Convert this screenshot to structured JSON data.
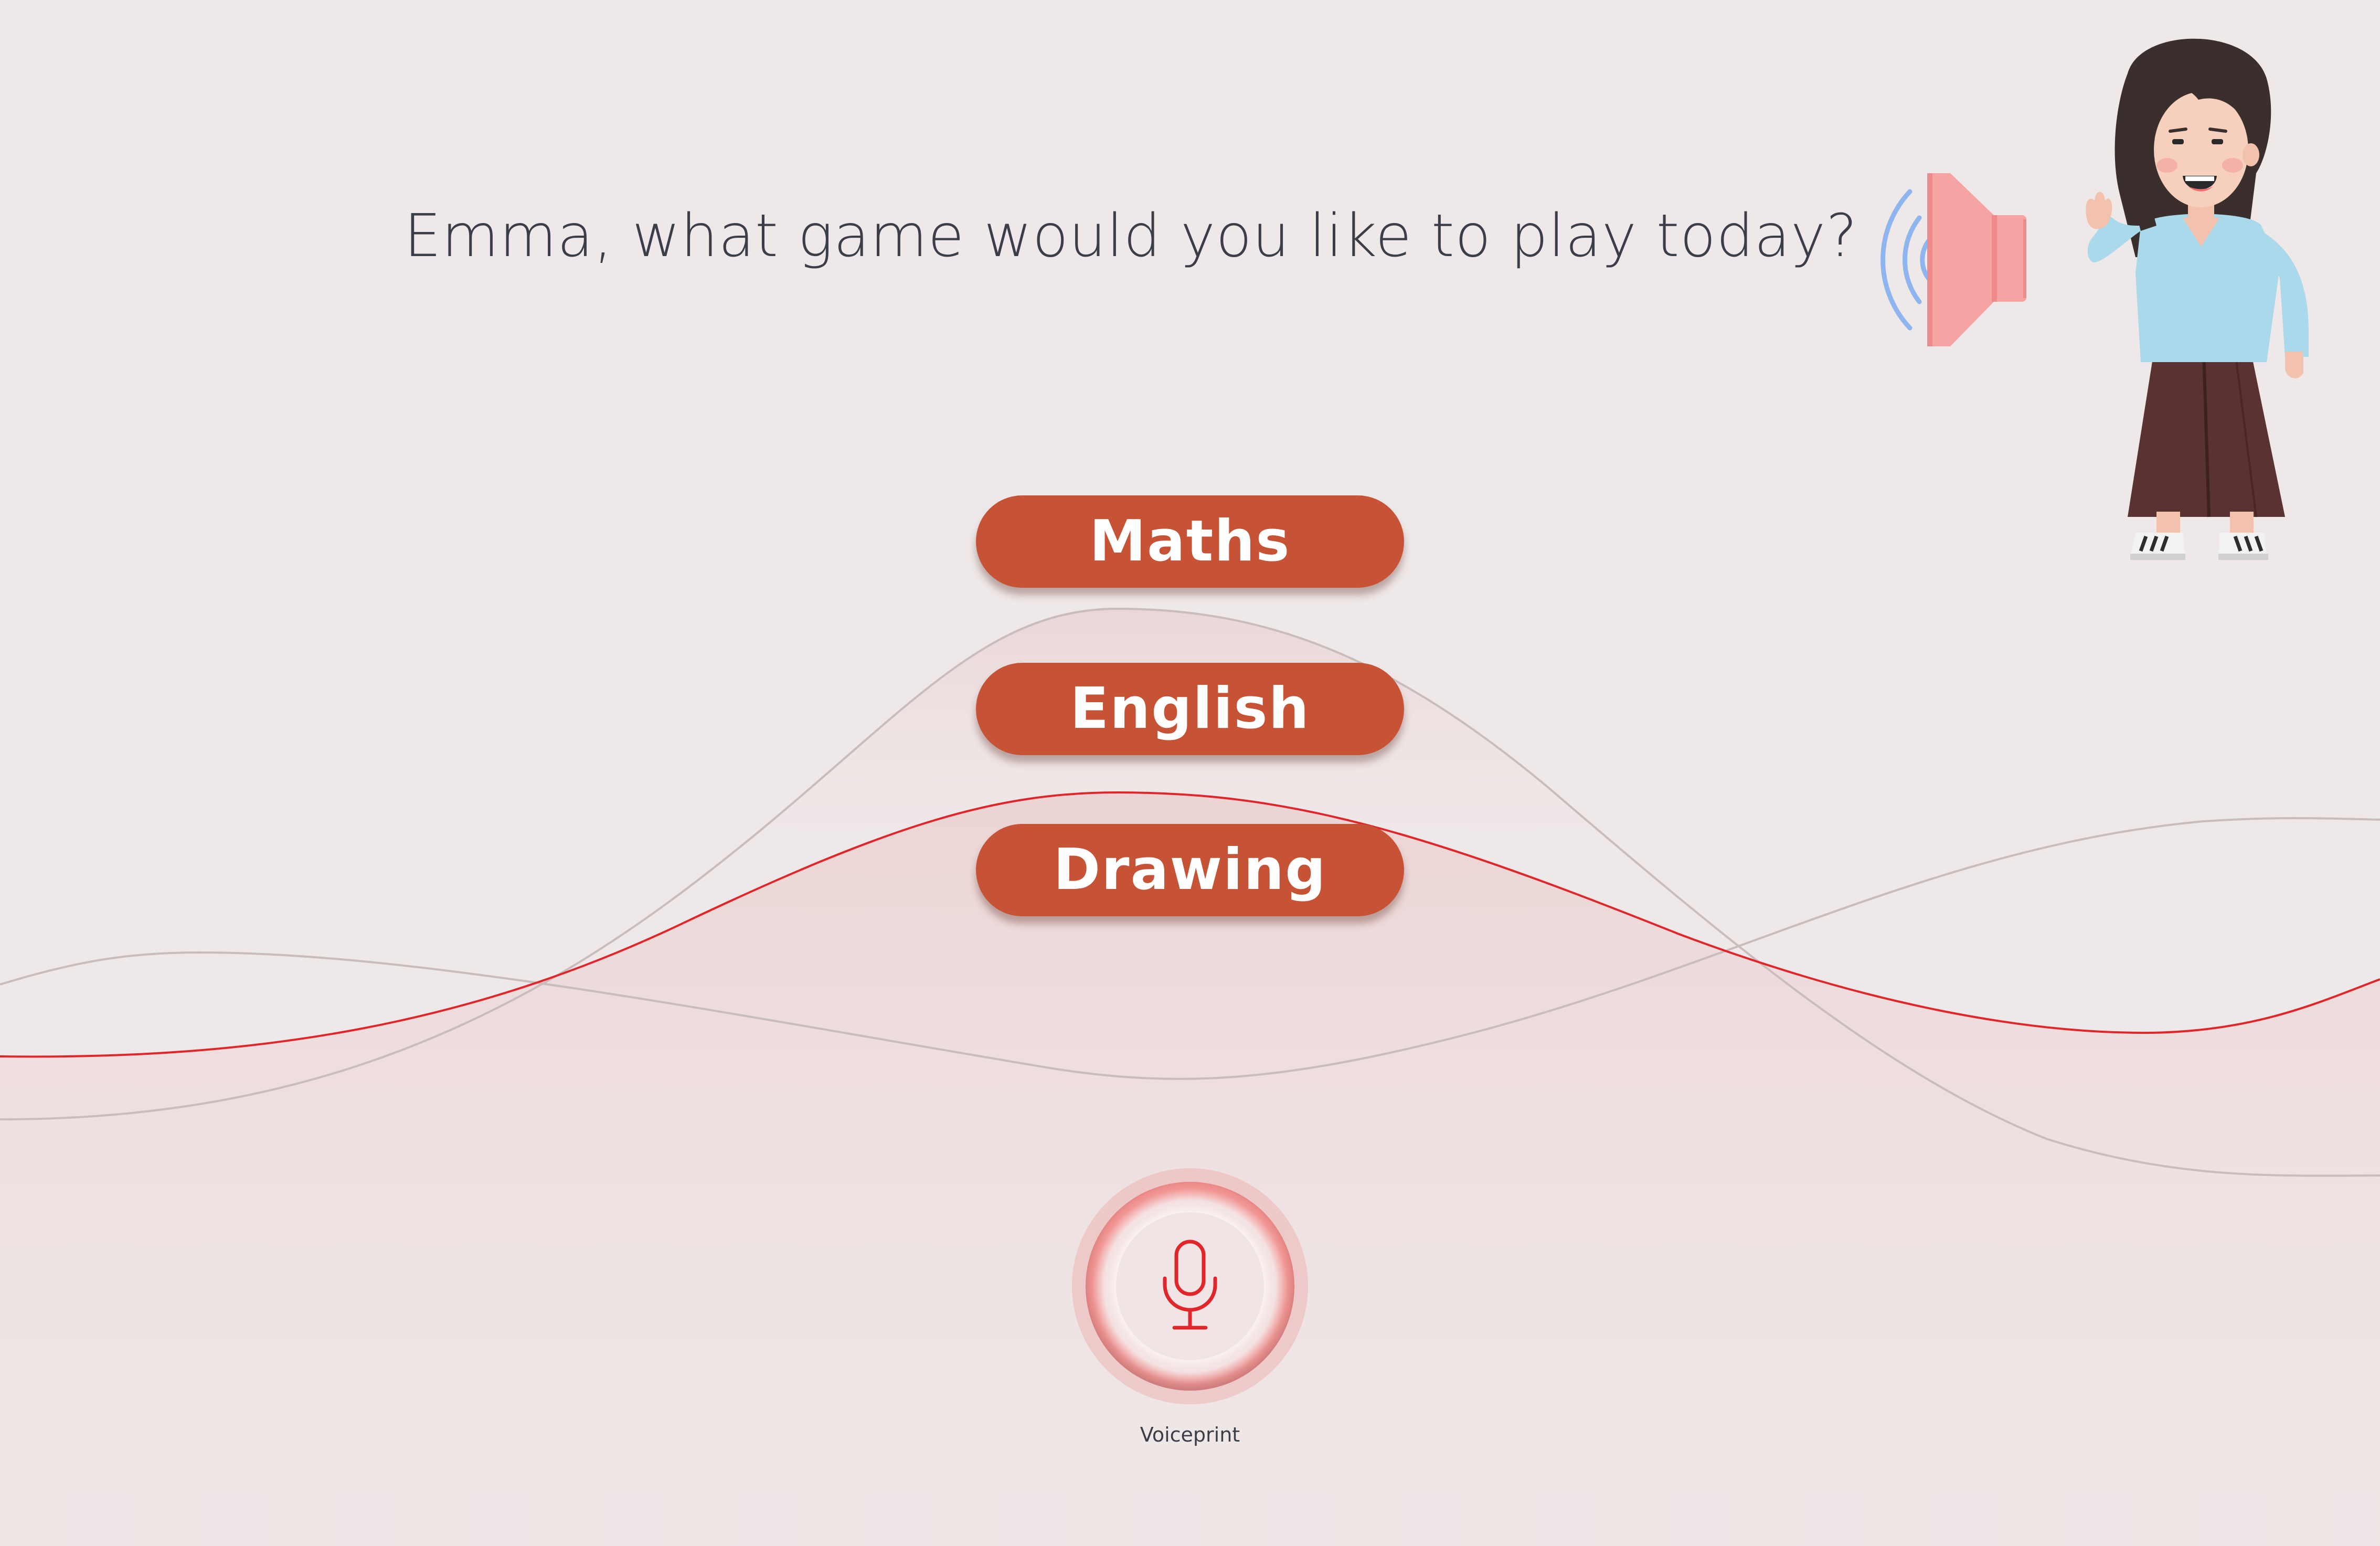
{
  "prompt": {
    "question": "Emma, what game would you like to play today?"
  },
  "speaker": {
    "icon": "speaker-volume-icon"
  },
  "assistant": {
    "icon": "teacher-character-illustration"
  },
  "choices": [
    {
      "label": "Maths"
    },
    {
      "label": "English"
    },
    {
      "label": "Drawing"
    }
  ],
  "voice": {
    "label": "Voiceprint",
    "icon": "microphone-icon"
  },
  "colors": {
    "background": "#efe8e8",
    "button": "#c65335",
    "button_text": "#ffffff",
    "text": "#3b3e48",
    "wave_red": "#e0262a",
    "wave_gray": "#c8bcbc",
    "speaker": "#f5a3a3",
    "speaker_waves": "#8fb5ee",
    "mic_red": "#e0262a"
  }
}
